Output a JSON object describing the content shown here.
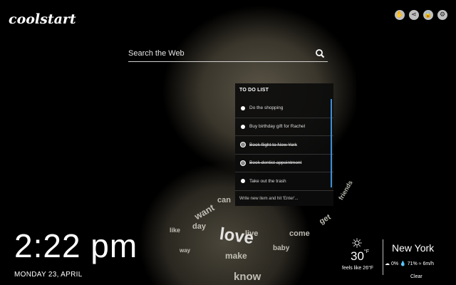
{
  "app": {
    "logo": "coolstart"
  },
  "top_icons": [
    {
      "name": "hand-icon",
      "glyph": "✋"
    },
    {
      "name": "share-icon",
      "glyph": "⋖"
    },
    {
      "name": "lock-icon",
      "glyph": "🔒"
    },
    {
      "name": "gear-icon",
      "glyph": "⚙"
    }
  ],
  "search": {
    "placeholder": "Search the Web"
  },
  "todo": {
    "title": "TO DO LIST",
    "items": [
      {
        "text": "Do the shopping",
        "done": false
      },
      {
        "text": "Buy birthday gift for Rachel",
        "done": false
      },
      {
        "text": "Book flight to New York",
        "done": true
      },
      {
        "text": "Book dentist appointment",
        "done": true
      },
      {
        "text": "Take out the trash",
        "done": false
      }
    ],
    "input_placeholder": "Write new item and hit 'Enter'..."
  },
  "clock": {
    "time": "2:22 pm",
    "date": "MONDAY 23, APRIL"
  },
  "weather": {
    "temp": "30",
    "unit": "°F",
    "feels_like": "feels like 26°F",
    "city": "New York",
    "precip": "0%",
    "humidity": "71%",
    "wind": "6m/h",
    "condition": "Clear"
  },
  "background_words": [
    "love",
    "make",
    "live",
    "come",
    "baby",
    "know",
    "day",
    "way",
    "like",
    "want",
    "can",
    "get",
    "friends"
  ]
}
